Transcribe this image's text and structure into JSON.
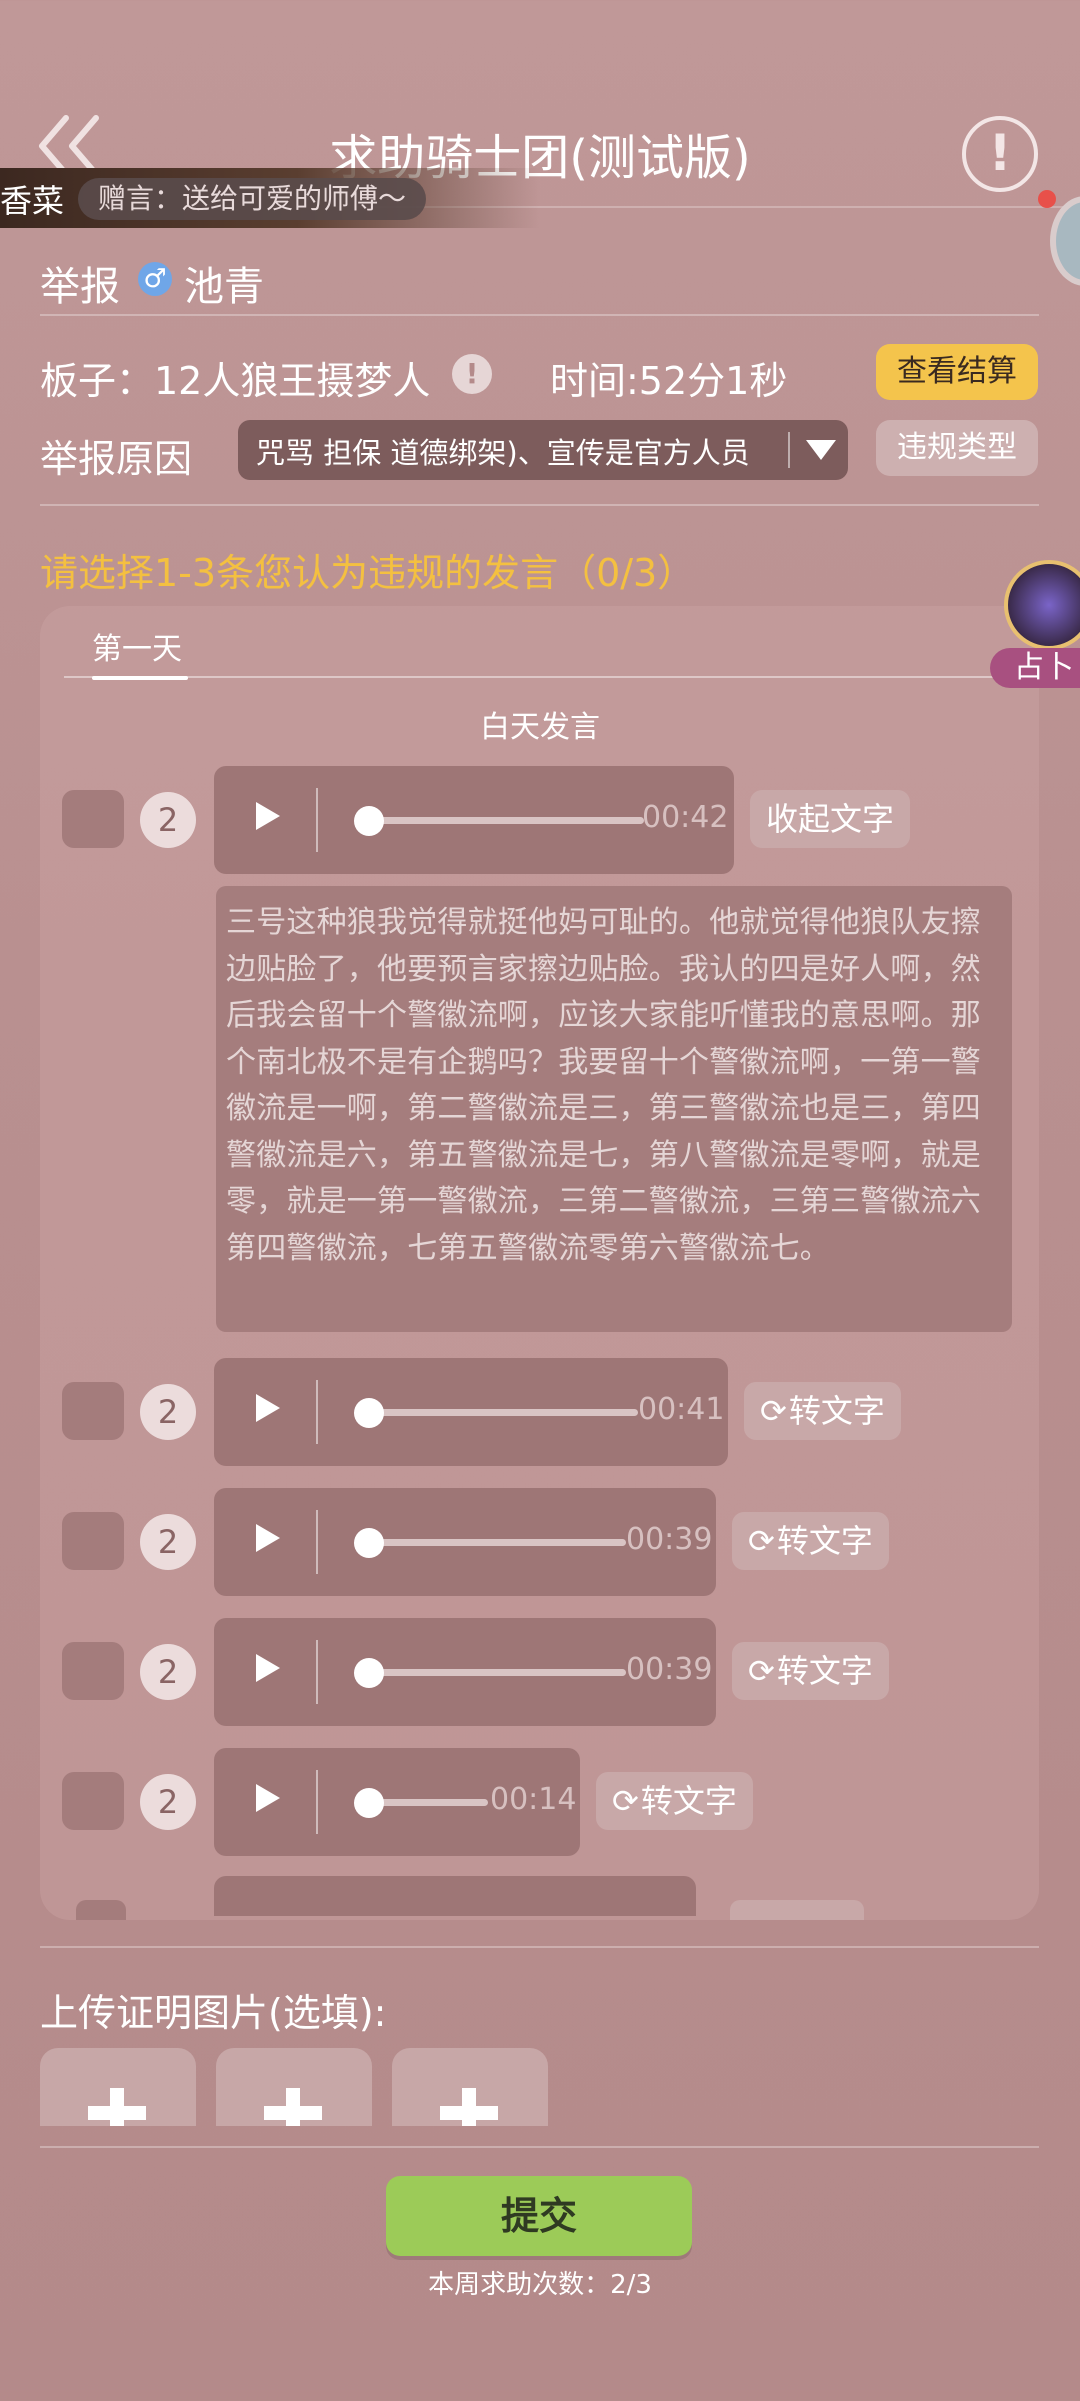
{
  "header": {
    "title": "求助骑士团(测试版)",
    "back_icon": "double-chevron-left-icon",
    "alert_icon": "exclamation-circle-icon",
    "alert_glyph": "!"
  },
  "gift": {
    "name": "香菜",
    "message": "赠言：送给可爱的师傅～"
  },
  "report": {
    "label": "举报",
    "gender_icon": "♂",
    "target_name": "池青"
  },
  "board": {
    "label": "板子：12人狼王摄梦人",
    "info_glyph": "!",
    "time_label": "时间:52分1秒",
    "view_settlement": "查看结算"
  },
  "reason": {
    "label": "举报原因",
    "selected": "咒骂 担保 道德绑架)、宣传是官方人员",
    "violation_type_button": "违规类型"
  },
  "prompt": "请选择1-3条您认为违规的发言（0/3）",
  "divination": {
    "label": "占卜"
  },
  "speech": {
    "day_tab": "第一天",
    "section_title": "白天发言",
    "items": [
      {
        "seat": "2",
        "duration": "00:42",
        "action": "收起文字"
      },
      {
        "seat": "2",
        "duration": "00:41",
        "action": "转文字"
      },
      {
        "seat": "2",
        "duration": "00:39",
        "action": "转文字"
      },
      {
        "seat": "2",
        "duration": "00:39",
        "action": "转文字"
      },
      {
        "seat": "2",
        "duration": "00:14",
        "action": "转文字"
      }
    ],
    "transcript": "三号这种狼我觉得就挺他妈可耻的。他就觉得他狼队友擦边贴脸了，他要预言家擦边贴脸。我认的四是好人啊，然后我会留十个警徽流啊，应该大家能听懂我的意思啊。那个南北极不是有企鹅吗？我要留十个警徽流啊，一第一警徽流是一啊，第二警徽流是三，第三警徽流也是三，第四警徽流是六，第五警徽流是七，第八警徽流是零啊，就是零，就是一第一警徽流，三第二警徽流，三第三警徽流六第四警徽流，七第五警徽流零第六警徽流七。"
  },
  "upload": {
    "label": "上传证明图片(选填):",
    "box_icon": "plus-icon"
  },
  "submit": {
    "label": "提交",
    "weekly_count": "本周求助次数：2/3"
  },
  "colors": {
    "background": "#b99090",
    "accent_yellow": "#f4c44c",
    "prompt_yellow": "#f4c040",
    "submit_green": "#9ccb58"
  }
}
